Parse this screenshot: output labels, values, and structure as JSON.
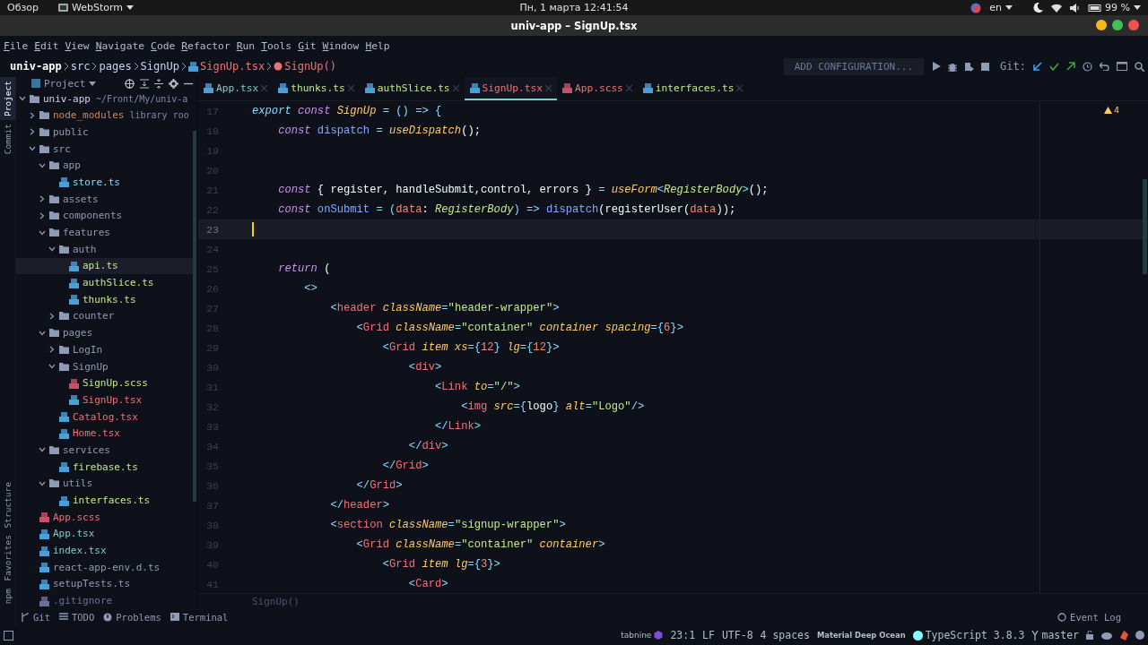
{
  "system_bar": {
    "activities": "Обзор",
    "app": "WebStorm",
    "clock": "Пн, 1 марта  12:41:54",
    "language": "en",
    "battery": "99 %"
  },
  "window": {
    "title": "univ-app – SignUp.tsx"
  },
  "menu": [
    "File",
    "Edit",
    "View",
    "Navigate",
    "Code",
    "Refactor",
    "Run",
    "Tools",
    "Git",
    "Window",
    "Help"
  ],
  "breadcrumbs": [
    {
      "text": "univ-app",
      "kind": "project"
    },
    {
      "text": "src",
      "kind": "folder"
    },
    {
      "text": "pages",
      "kind": "folder"
    },
    {
      "text": "SignUp",
      "kind": "folder"
    },
    {
      "text": "SignUp.tsx",
      "kind": "file"
    },
    {
      "text": "SignUp()",
      "kind": "function"
    }
  ],
  "toolbar": {
    "run_config": "ADD CONFIGURATION...",
    "git_label": "Git:"
  },
  "side_tabs": [
    {
      "label": "Project",
      "selected": true
    },
    {
      "label": "Commit",
      "selected": false
    }
  ],
  "side_tabs_bottom": [
    {
      "label": "Structure",
      "selected": false
    },
    {
      "label": "Favorites",
      "selected": false
    },
    {
      "label": "npm",
      "selected": false
    }
  ],
  "project": {
    "title": "Project",
    "tree": [
      {
        "name": "univ-app",
        "hint": "~/Front/My/univ-a",
        "kind": "folder",
        "color": "#c8d3f5",
        "expanded": true,
        "selected": false,
        "children": [
          {
            "name": "node_modules",
            "hint": "library roo",
            "kind": "folder",
            "color": "#c98a5a",
            "expanded": false,
            "selected": false
          },
          {
            "name": "public",
            "kind": "folder",
            "color": "#8f9bb3",
            "expanded": false,
            "selected": false
          },
          {
            "name": "src",
            "kind": "folder",
            "color": "#8f9bb3",
            "expanded": true,
            "selected": false,
            "children": [
              {
                "name": "app",
                "kind": "folder",
                "color": "#8f9bb3",
                "expanded": true,
                "selected": false,
                "children": [
                  {
                    "name": "store.ts",
                    "kind": "ts",
                    "color": "#89ddff",
                    "selected": false
                  }
                ]
              },
              {
                "name": "assets",
                "kind": "folder",
                "color": "#8f9bb3",
                "expanded": false,
                "selected": false
              },
              {
                "name": "components",
                "kind": "folder",
                "color": "#8f9bb3",
                "expanded": false,
                "selected": false
              },
              {
                "name": "features",
                "kind": "folder",
                "color": "#8f9bb3",
                "expanded": true,
                "selected": false,
                "children": [
                  {
                    "name": "auth",
                    "kind": "folder",
                    "color": "#8f9bb3",
                    "expanded": true,
                    "selected": false,
                    "children": [
                      {
                        "name": "api.ts",
                        "kind": "ts",
                        "color": "#c3e88d",
                        "selected": true
                      },
                      {
                        "name": "authSlice.ts",
                        "kind": "ts",
                        "color": "#c3e88d",
                        "selected": false
                      },
                      {
                        "name": "thunks.ts",
                        "kind": "ts",
                        "color": "#c3e88d",
                        "selected": false
                      }
                    ]
                  },
                  {
                    "name": "counter",
                    "kind": "folder",
                    "color": "#8f9bb3",
                    "expanded": false,
                    "selected": false
                  }
                ]
              },
              {
                "name": "pages",
                "kind": "folder",
                "color": "#8f9bb3",
                "expanded": true,
                "selected": false,
                "children": [
                  {
                    "name": "LogIn",
                    "kind": "folder",
                    "color": "#8f9bb3",
                    "expanded": false,
                    "selected": false
                  },
                  {
                    "name": "SignUp",
                    "kind": "folder",
                    "color": "#8f9bb3",
                    "expanded": true,
                    "selected": false,
                    "children": [
                      {
                        "name": "SignUp.scss",
                        "kind": "scss",
                        "color": "#c3e88d",
                        "selected": false
                      },
                      {
                        "name": "SignUp.tsx",
                        "kind": "ts",
                        "color": "#f07178",
                        "selected": false
                      }
                    ]
                  },
                  {
                    "name": "Catalog.tsx",
                    "kind": "ts",
                    "color": "#f07178",
                    "selected": false
                  },
                  {
                    "name": "Home.tsx",
                    "kind": "ts",
                    "color": "#f07178",
                    "selected": false
                  }
                ]
              },
              {
                "name": "services",
                "kind": "folder",
                "color": "#8f9bb3",
                "expanded": true,
                "selected": false,
                "children": [
                  {
                    "name": "firebase.ts",
                    "kind": "ts",
                    "color": "#c3e88d",
                    "selected": false
                  }
                ]
              },
              {
                "name": "utils",
                "kind": "folder",
                "color": "#8f9bb3",
                "expanded": true,
                "selected": false,
                "children": [
                  {
                    "name": "interfaces.ts",
                    "kind": "ts",
                    "color": "#c3e88d",
                    "selected": false
                  }
                ]
              }
            ]
          },
          {
            "name": "App.scss",
            "kind": "scss",
            "color": "#f07178",
            "selected": false
          },
          {
            "name": "App.tsx",
            "kind": "ts",
            "color": "#80cbc4",
            "selected": false
          },
          {
            "name": "index.tsx",
            "kind": "ts",
            "color": "#80cbc4",
            "selected": false
          },
          {
            "name": "react-app-env.d.ts",
            "kind": "ts",
            "color": "#8f9bb3",
            "selected": false
          },
          {
            "name": "setupTests.ts",
            "kind": "ts",
            "color": "#8f9bb3",
            "selected": false
          },
          {
            "name": ".gitignore",
            "kind": "text",
            "color": "#6b7394",
            "selected": false
          }
        ]
      }
    ]
  },
  "tabs": [
    {
      "label": "App.tsx",
      "kind": "ts",
      "color": "#80cbc4",
      "selected": false
    },
    {
      "label": "thunks.ts",
      "kind": "ts",
      "color": "#c3e88d",
      "selected": false
    },
    {
      "label": "authSlice.ts",
      "kind": "ts",
      "color": "#c3e88d",
      "selected": false
    },
    {
      "label": "SignUp.tsx",
      "kind": "ts",
      "color": "#f07178",
      "selected": true
    },
    {
      "label": "App.scss",
      "kind": "scss",
      "color": "#f07178",
      "selected": false
    },
    {
      "label": "interfaces.ts",
      "kind": "ts",
      "color": "#c3e88d",
      "selected": false
    }
  ],
  "editor": {
    "warnings": "4",
    "breadcrumb": "SignUp()",
    "lines": [
      {
        "number": "17",
        "current": false,
        "tokens": [
          {
            "kind": "exp",
            "text": "export"
          },
          {
            "kind": "kw",
            "text": " const "
          },
          {
            "kind": "fn",
            "text": "SignUp"
          },
          {
            "kind": "punct",
            "text": " = () => {"
          }
        ]
      },
      {
        "number": "18",
        "current": false,
        "tokens": [
          {
            "kind": "kw",
            "text": "    const"
          },
          {
            "kind": "var",
            "text": " dispatch"
          },
          {
            "kind": "punct",
            "text": " = "
          },
          {
            "kind": "fn",
            "text": "useDispatch"
          },
          {
            "kind": "plain",
            "text": "();"
          }
        ]
      },
      {
        "number": "19",
        "current": false
      },
      {
        "number": "20",
        "current": false
      },
      {
        "number": "21",
        "current": false,
        "tokens": [
          {
            "kind": "kw",
            "text": "    const"
          },
          {
            "kind": "plain",
            "text": " { register, handleSubmit,control, errors } "
          },
          {
            "kind": "punct",
            "text": "= "
          },
          {
            "kind": "fn",
            "text": "useForm"
          },
          {
            "kind": "punct",
            "text": "<"
          },
          {
            "kind": "type",
            "text": "RegisterBody"
          },
          {
            "kind": "punct",
            "text": ">"
          },
          {
            "kind": "plain",
            "text": "();"
          }
        ]
      },
      {
        "number": "22",
        "current": false,
        "tokens": [
          {
            "kind": "kw",
            "text": "    const"
          },
          {
            "kind": "var",
            "text": " onSubmit"
          },
          {
            "kind": "punct",
            "text": " = ("
          },
          {
            "kind": "param",
            "text": "data"
          },
          {
            "kind": "plain",
            "text": ": "
          },
          {
            "kind": "type",
            "text": "RegisterBody"
          },
          {
            "kind": "punct",
            "text": ") => "
          },
          {
            "kind": "var",
            "text": "dispatch"
          },
          {
            "kind": "plain",
            "text": "(registerUser("
          },
          {
            "kind": "param",
            "text": "data"
          },
          {
            "kind": "plain",
            "text": "));"
          }
        ]
      },
      {
        "number": "23",
        "current": true
      },
      {
        "number": "24",
        "current": false
      },
      {
        "number": "25",
        "current": false,
        "tokens": [
          {
            "kind": "kw",
            "text": "    return"
          },
          {
            "kind": "plain",
            "text": " ("
          }
        ]
      },
      {
        "number": "26",
        "current": false,
        "tokens": [
          {
            "kind": "punct",
            "text": "        <>"
          }
        ]
      },
      {
        "number": "27",
        "current": false,
        "tokens": [
          {
            "kind": "punct",
            "text": "            <"
          },
          {
            "kind": "tag",
            "text": "header"
          },
          {
            "kind": "attr",
            "text": " className"
          },
          {
            "kind": "punct",
            "text": "="
          },
          {
            "kind": "str",
            "text": "\"header-wrapper\""
          },
          {
            "kind": "punct",
            "text": ">"
          }
        ]
      },
      {
        "number": "28",
        "current": false,
        "tokens": [
          {
            "kind": "punct",
            "text": "                <"
          },
          {
            "kind": "tag",
            "text": "Grid"
          },
          {
            "kind": "attr",
            "text": " className"
          },
          {
            "kind": "punct",
            "text": "="
          },
          {
            "kind": "str",
            "text": "\"container\""
          },
          {
            "kind": "attr",
            "text": " container spacing"
          },
          {
            "kind": "punct",
            "text": "={"
          },
          {
            "kind": "num",
            "text": "6"
          },
          {
            "kind": "punct",
            "text": "}>"
          }
        ]
      },
      {
        "number": "29",
        "current": false,
        "tokens": [
          {
            "kind": "punct",
            "text": "                    <"
          },
          {
            "kind": "tag",
            "text": "Grid"
          },
          {
            "kind": "attr",
            "text": " item xs"
          },
          {
            "kind": "punct",
            "text": "={"
          },
          {
            "kind": "num",
            "text": "12"
          },
          {
            "kind": "punct",
            "text": "}"
          },
          {
            "kind": "attr",
            "text": " lg"
          },
          {
            "kind": "punct",
            "text": "={"
          },
          {
            "kind": "num",
            "text": "12"
          },
          {
            "kind": "punct",
            "text": "}>"
          }
        ]
      },
      {
        "number": "30",
        "current": false,
        "tokens": [
          {
            "kind": "punct",
            "text": "                        <"
          },
          {
            "kind": "tag",
            "text": "div"
          },
          {
            "kind": "punct",
            "text": ">"
          }
        ]
      },
      {
        "number": "31",
        "current": false,
        "tokens": [
          {
            "kind": "punct",
            "text": "                            <"
          },
          {
            "kind": "tag",
            "text": "Link"
          },
          {
            "kind": "attr",
            "text": " to"
          },
          {
            "kind": "punct",
            "text": "="
          },
          {
            "kind": "str",
            "text": "\"/\""
          },
          {
            "kind": "punct",
            "text": ">"
          }
        ]
      },
      {
        "number": "32",
        "current": false,
        "tokens": [
          {
            "kind": "punct",
            "text": "                                <"
          },
          {
            "kind": "tag",
            "text": "img"
          },
          {
            "kind": "attr",
            "text": " src"
          },
          {
            "kind": "punct",
            "text": "={"
          },
          {
            "kind": "plain",
            "text": "logo"
          },
          {
            "kind": "punct",
            "text": "}"
          },
          {
            "kind": "attr",
            "text": " alt"
          },
          {
            "kind": "punct",
            "text": "="
          },
          {
            "kind": "str",
            "text": "\"Logo\""
          },
          {
            "kind": "punct",
            "text": "/>"
          }
        ]
      },
      {
        "number": "33",
        "current": false,
        "tokens": [
          {
            "kind": "punct",
            "text": "                            </"
          },
          {
            "kind": "tag",
            "text": "Link"
          },
          {
            "kind": "punct",
            "text": ">"
          }
        ]
      },
      {
        "number": "34",
        "current": false,
        "tokens": [
          {
            "kind": "punct",
            "text": "                        </"
          },
          {
            "kind": "tag",
            "text": "div"
          },
          {
            "kind": "punct",
            "text": ">"
          }
        ]
      },
      {
        "number": "35",
        "current": false,
        "tokens": [
          {
            "kind": "punct",
            "text": "                    </"
          },
          {
            "kind": "tag",
            "text": "Grid"
          },
          {
            "kind": "punct",
            "text": ">"
          }
        ]
      },
      {
        "number": "36",
        "current": false,
        "tokens": [
          {
            "kind": "punct",
            "text": "                </"
          },
          {
            "kind": "tag",
            "text": "Grid"
          },
          {
            "kind": "punct",
            "text": ">"
          }
        ]
      },
      {
        "number": "37",
        "current": false,
        "tokens": [
          {
            "kind": "punct",
            "text": "            </"
          },
          {
            "kind": "tag",
            "text": "header"
          },
          {
            "kind": "punct",
            "text": ">"
          }
        ]
      },
      {
        "number": "38",
        "current": false,
        "tokens": [
          {
            "kind": "punct",
            "text": "            <"
          },
          {
            "kind": "tag",
            "text": "section"
          },
          {
            "kind": "attr",
            "text": " className"
          },
          {
            "kind": "punct",
            "text": "="
          },
          {
            "kind": "str",
            "text": "\"signup-wrapper\""
          },
          {
            "kind": "punct",
            "text": ">"
          }
        ]
      },
      {
        "number": "39",
        "current": false,
        "tokens": [
          {
            "kind": "punct",
            "text": "                <"
          },
          {
            "kind": "tag",
            "text": "Grid"
          },
          {
            "kind": "attr",
            "text": " className"
          },
          {
            "kind": "punct",
            "text": "="
          },
          {
            "kind": "str",
            "text": "\"container\""
          },
          {
            "kind": "attr",
            "text": " container"
          },
          {
            "kind": "punct",
            "text": ">"
          }
        ]
      },
      {
        "number": "40",
        "current": false,
        "tokens": [
          {
            "kind": "punct",
            "text": "                    <"
          },
          {
            "kind": "tag",
            "text": "Grid"
          },
          {
            "kind": "attr",
            "text": " item lg"
          },
          {
            "kind": "punct",
            "text": "={"
          },
          {
            "kind": "num",
            "text": "3"
          },
          {
            "kind": "punct",
            "text": "}>"
          }
        ]
      },
      {
        "number": "41",
        "current": false,
        "tokens": [
          {
            "kind": "punct",
            "text": "                        <"
          },
          {
            "kind": "tag",
            "text": "Card"
          },
          {
            "kind": "punct",
            "text": ">"
          }
        ]
      }
    ]
  },
  "tool_windows": [
    {
      "label": "Git",
      "kind": "git"
    },
    {
      "label": "TODO",
      "kind": "todo"
    },
    {
      "label": "Problems",
      "kind": "problems"
    },
    {
      "label": "Terminal",
      "kind": "terminal"
    }
  ],
  "event_log": "Event Log",
  "status_bar": {
    "plugin": "tabnine",
    "position": "23:1",
    "line_separator": "LF",
    "encoding": "UTF-8",
    "indent": "4 spaces",
    "theme": "Material Deep Ocean",
    "language": "TypeScript 3.8.3",
    "branch": "master"
  }
}
